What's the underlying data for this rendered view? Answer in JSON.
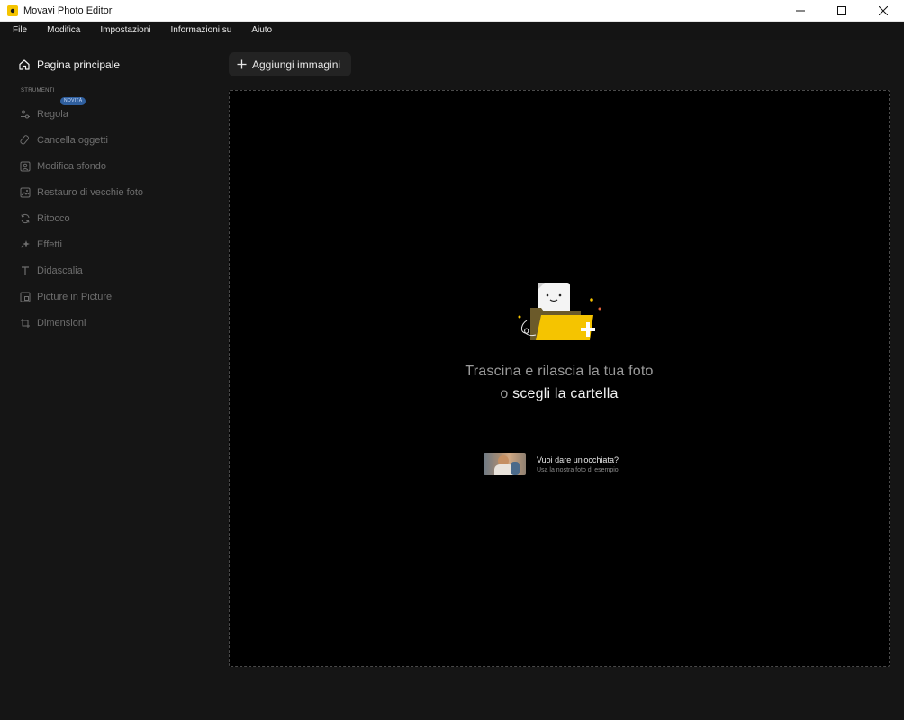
{
  "window": {
    "title": "Movavi Photo Editor"
  },
  "menu": [
    "File",
    "Modifica",
    "Impostazioni",
    "Informazioni su",
    "Aiuto"
  ],
  "sidebar": {
    "home_label": "Pagina principale",
    "section_title": "STRUMENTI",
    "new_badge": "NOVITÀ",
    "tools": [
      {
        "label": "Regola",
        "icon": "sliders-icon"
      },
      {
        "label": "Cancella oggetti",
        "icon": "eraser-icon"
      },
      {
        "label": "Modifica sfondo",
        "icon": "portrait-icon"
      },
      {
        "label": "Restauro di vecchie foto",
        "icon": "photo-icon"
      },
      {
        "label": "Ritocco",
        "icon": "refresh-icon"
      },
      {
        "label": "Effetti",
        "icon": "sparkle-icon"
      },
      {
        "label": "Didascalia",
        "icon": "text-icon"
      },
      {
        "label": "Picture in Picture",
        "icon": "pip-icon"
      },
      {
        "label": "Dimensioni",
        "icon": "crop-icon"
      }
    ]
  },
  "toolbar": {
    "add_images_label": "Aggiungi immagini"
  },
  "dropzone": {
    "line1": "Trascina e rilascia la tua foto",
    "or_text": "o",
    "folder_link": "scegli la cartella",
    "sample_title": "Vuoi dare un'occhiata?",
    "sample_subtitle": "Usa la nostra foto di esempio"
  },
  "colors": {
    "accent_yellow": "#f5c400",
    "badge_blue": "#2f5f9e",
    "background": "#151515",
    "dropzone_bg": "#000000"
  }
}
